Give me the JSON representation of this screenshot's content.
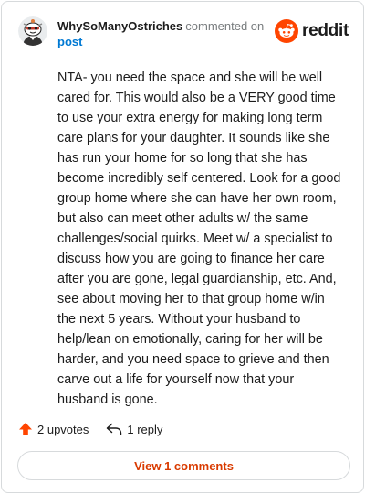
{
  "comment": {
    "username": "WhySoManyOstriches",
    "commented_on": "commented on",
    "post_link": "post",
    "body": "NTA- you need the space and she will be well cared for. This would also be a VERY good time to use your extra energy for making long term care plans for your daughter. It sounds like she has run your home for so long that she has become incredibly self centered. Look for a good group home where she can have her own room, but also can meet other adults w/ the same challenges/social quirks. Meet w/ a specialist to discuss how you are going to finance her care after you are gone, legal guardianship, etc. And, see about moving her to that group home w/in the next 5 years. Without your husband to help/lean on emotionally, caring for her will be harder, and you need space to grieve and then carve out a life for yourself now that your husband is gone.",
    "upvotes": "2 upvotes",
    "replies": "1 reply",
    "view_comments": "View 1 comments"
  },
  "logo": {
    "text": "reddit",
    "icon": "reddit-alien-icon",
    "color": "#ff4500"
  },
  "colors": {
    "accent": "#d93a00",
    "upvote": "#ff4500",
    "link": "#0079d3",
    "border": "#d7dadc"
  }
}
